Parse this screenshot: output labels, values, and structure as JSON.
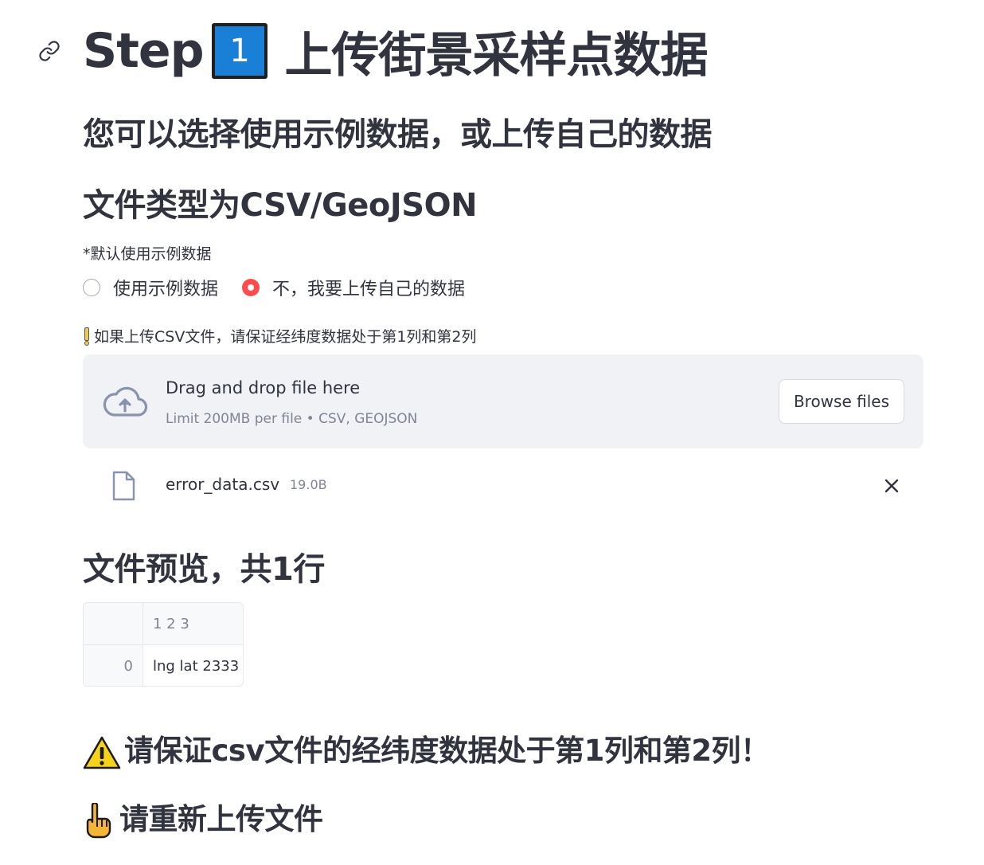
{
  "header": {
    "step_word": "Step",
    "step_number": "1",
    "title": "上传街景采样点数据"
  },
  "subtitle": "您可以选择使用示例数据，或上传自己的数据",
  "file_type_heading": "文件类型为CSV/GeoJSON",
  "radio": {
    "label": "*默认使用示例数据",
    "options": [
      {
        "label": "使用示例数据",
        "selected": false
      },
      {
        "label": "不，我要上传自己的数据",
        "selected": true
      }
    ]
  },
  "notice": "如果上传CSV文件，请保证经纬度数据处于第1列和第2列",
  "uploader": {
    "title": "Drag and drop file here",
    "limit": "Limit 200MB per file • CSV, GEOJSON",
    "browse_label": "Browse files"
  },
  "file": {
    "name": "error_data.csv",
    "size": "19.0B"
  },
  "preview_heading": "文件预览，共1行",
  "table": {
    "header": "1 2 3",
    "rows": [
      {
        "index": "0",
        "value": "lng lat 2333"
      }
    ]
  },
  "warning": "请保证csv文件的经纬度数据处于第1列和第2列！",
  "reupload": "请重新上传文件",
  "colors": {
    "accent": "#ff4b4b",
    "text": "#31333f",
    "muted": "#808495",
    "dropzone_bg": "#f0f2f6",
    "keycap_blue": "#1a7fd6"
  },
  "icons": {
    "anchor": "link-icon",
    "upload": "cloud-upload-icon",
    "file": "file-icon",
    "remove": "close-icon",
    "warning": "warning-icon",
    "hand": "pointing-up-icon",
    "notice": "exclamation-icon"
  }
}
